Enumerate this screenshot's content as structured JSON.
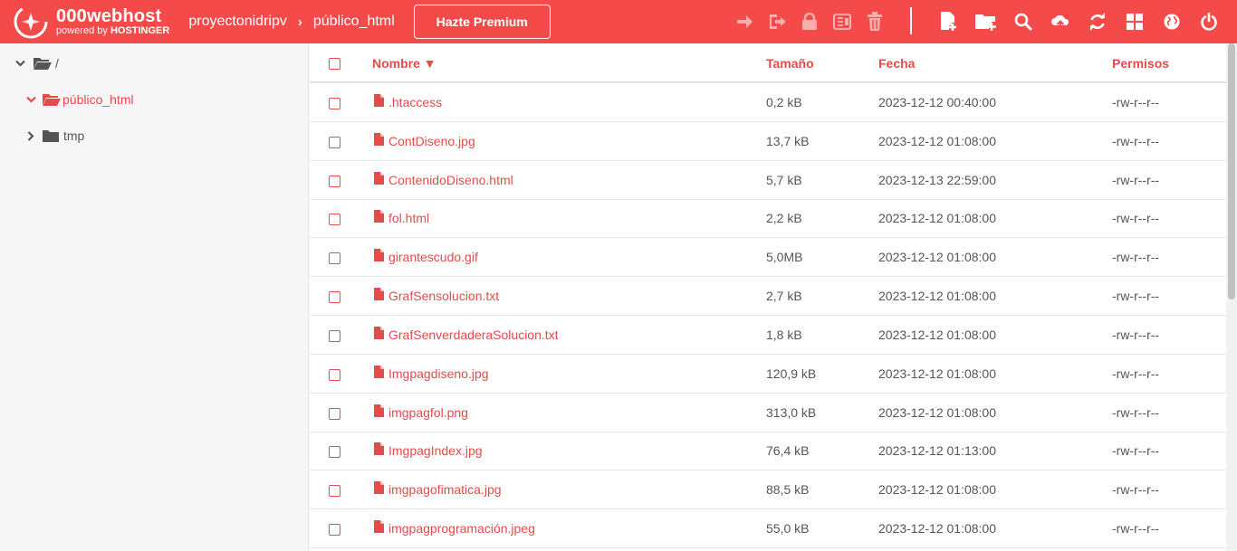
{
  "brand": {
    "title": "000webhost",
    "sub_prefix": "powered by ",
    "sub_brand": "HOSTINGER"
  },
  "breadcrumb": {
    "site": "proyectonidripv",
    "folder": "público_html"
  },
  "premium_label": "Hazte Premium",
  "toolbar": {
    "disabled": [
      "move-icon",
      "rename-icon",
      "lock-icon",
      "archive-icon",
      "trash-icon"
    ],
    "enabled": [
      "new-file-icon",
      "new-folder-icon",
      "search-icon",
      "upload-icon",
      "refresh-icon",
      "grid-view-icon",
      "globe-icon",
      "power-icon"
    ]
  },
  "tree": [
    {
      "label": "/",
      "expanded": true
    },
    {
      "label": "público_html",
      "expanded": true,
      "active": true
    },
    {
      "label": "tmp",
      "expanded": false
    }
  ],
  "table": {
    "headers": {
      "name": "Nombre ▼",
      "size": "Tamaño",
      "date": "Fecha",
      "perms": "Permisos"
    },
    "rows": [
      {
        "name": ".htaccess",
        "size": "0,2 kB",
        "date": "2023-12-12 00:40:00",
        "perms": "-rw-r--r--"
      },
      {
        "name": "ContDiseno.jpg",
        "size": "13,7 kB",
        "date": "2023-12-12 01:08:00",
        "perms": "-rw-r--r--"
      },
      {
        "name": "ContenidoDiseno.html",
        "size": "5,7 kB",
        "date": "2023-12-13 22:59:00",
        "perms": "-rw-r--r--"
      },
      {
        "name": "fol.html",
        "size": "2,2 kB",
        "date": "2023-12-12 01:08:00",
        "perms": "-rw-r--r--"
      },
      {
        "name": "girantescudo.gif",
        "size": "5,0MB",
        "date": "2023-12-12 01:08:00",
        "perms": "-rw-r--r--"
      },
      {
        "name": "GrafSensolucion.txt",
        "size": "2,7 kB",
        "date": "2023-12-12 01:08:00",
        "perms": "-rw-r--r--"
      },
      {
        "name": "GrafSenverdaderaSolucion.txt",
        "size": "1,8 kB",
        "date": "2023-12-12 01:08:00",
        "perms": "-rw-r--r--"
      },
      {
        "name": "Imgpagdiseno.jpg",
        "size": "120,9 kB",
        "date": "2023-12-12 01:08:00",
        "perms": "-rw-r--r--"
      },
      {
        "name": "imgpagfol.png",
        "size": "313,0 kB",
        "date": "2023-12-12 01:08:00",
        "perms": "-rw-r--r--"
      },
      {
        "name": "ImgpagIndex.jpg",
        "size": "76,4 kB",
        "date": "2023-12-12 01:13:00",
        "perms": "-rw-r--r--"
      },
      {
        "name": "imgpagofimatica.jpg",
        "size": "88,5 kB",
        "date": "2023-12-12 01:08:00",
        "perms": "-rw-r--r--"
      },
      {
        "name": "imgpagprogramación.jpeg",
        "size": "55,0 kB",
        "date": "2023-12-12 01:08:00",
        "perms": "-rw-r--r--"
      }
    ]
  },
  "colors": {
    "brand": "#f44a4a",
    "accent_text": "#e44b4b",
    "body_text": "#555555"
  }
}
